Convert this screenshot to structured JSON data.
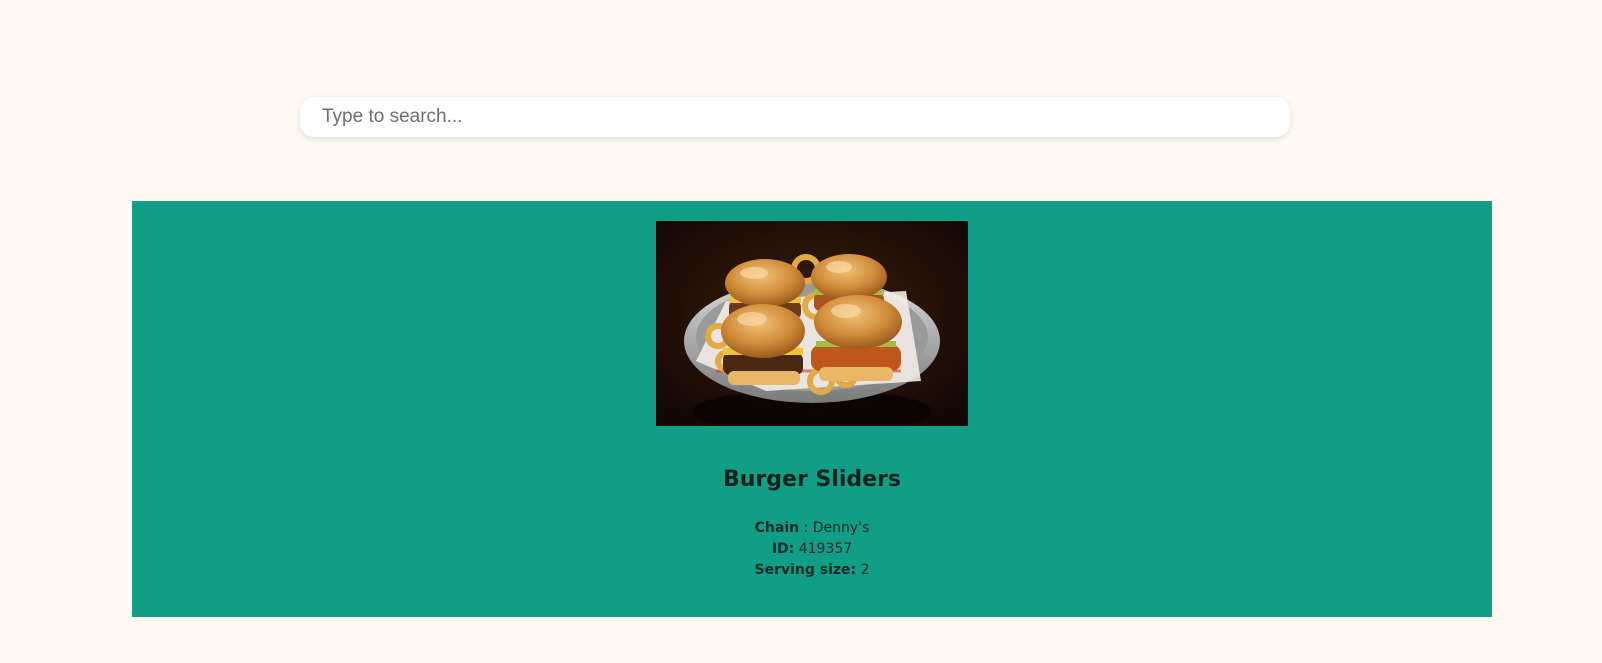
{
  "search": {
    "placeholder": "Type to search...",
    "value": ""
  },
  "result": {
    "title": "Burger Sliders",
    "image_icon": "food-photo",
    "chain_label": "Chain",
    "chain_sep": " : ",
    "chain_value": "Denny's",
    "id_label": "ID:",
    "id_value": "419357",
    "serving_label": "Serving size:",
    "serving_value": "2"
  },
  "colors": {
    "page_background": "#fff9f1",
    "card_background": "#109e87",
    "title_text": "#12211d"
  }
}
